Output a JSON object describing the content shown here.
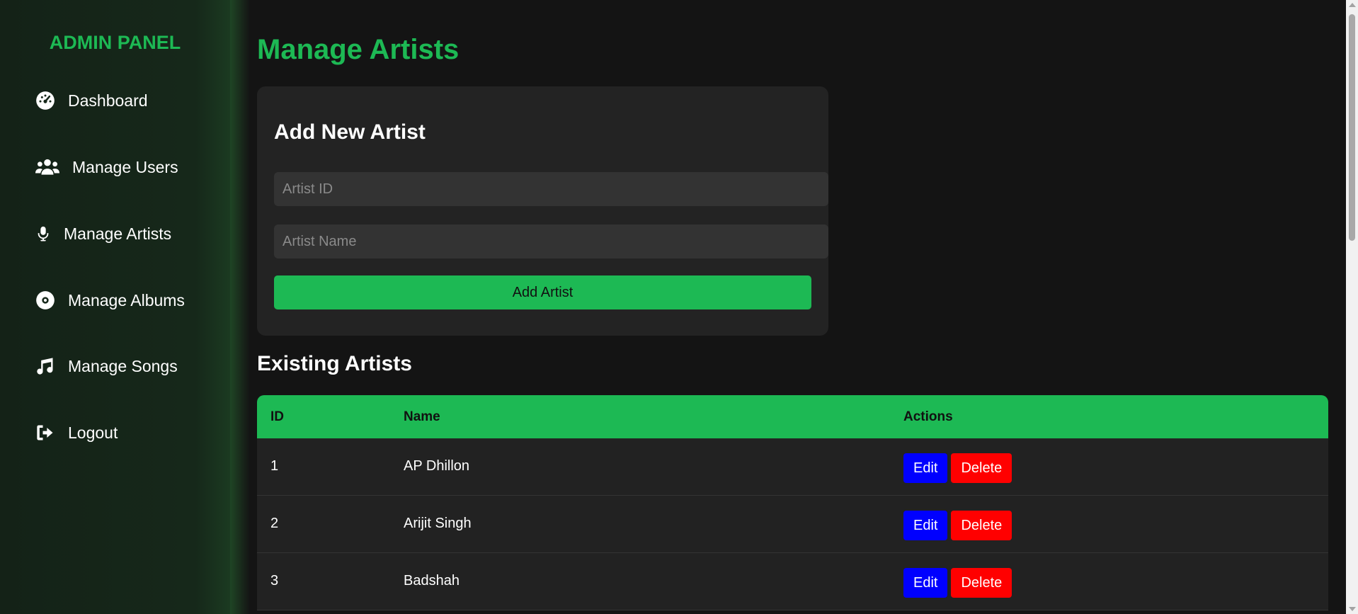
{
  "sidebar": {
    "brand": "ADMIN PANEL",
    "items": [
      {
        "label": "Dashboard",
        "icon": "gauge-icon"
      },
      {
        "label": "Manage Users",
        "icon": "users-icon"
      },
      {
        "label": "Manage Artists",
        "icon": "microphone-icon"
      },
      {
        "label": "Manage Albums",
        "icon": "disc-icon"
      },
      {
        "label": "Manage Songs",
        "icon": "music-note-icon"
      },
      {
        "label": "Logout",
        "icon": "logout-icon"
      }
    ]
  },
  "main": {
    "title": "Manage Artists",
    "form": {
      "title": "Add New Artist",
      "artist_id_placeholder": "Artist ID",
      "artist_name_placeholder": "Artist Name",
      "submit_label": "Add Artist"
    },
    "list_title": "Existing Artists",
    "table": {
      "headers": [
        "ID",
        "Name",
        "Actions"
      ],
      "rows": [
        {
          "id": "1",
          "name": "AP Dhillon"
        },
        {
          "id": "2",
          "name": "Arijit Singh"
        },
        {
          "id": "3",
          "name": "Badshah"
        }
      ],
      "edit_label": "Edit",
      "delete_label": "Delete"
    }
  },
  "colors": {
    "accent": "#1db954",
    "edit": "#0000ff",
    "delete": "#ff0000",
    "background": "#141414",
    "card": "#232323"
  }
}
